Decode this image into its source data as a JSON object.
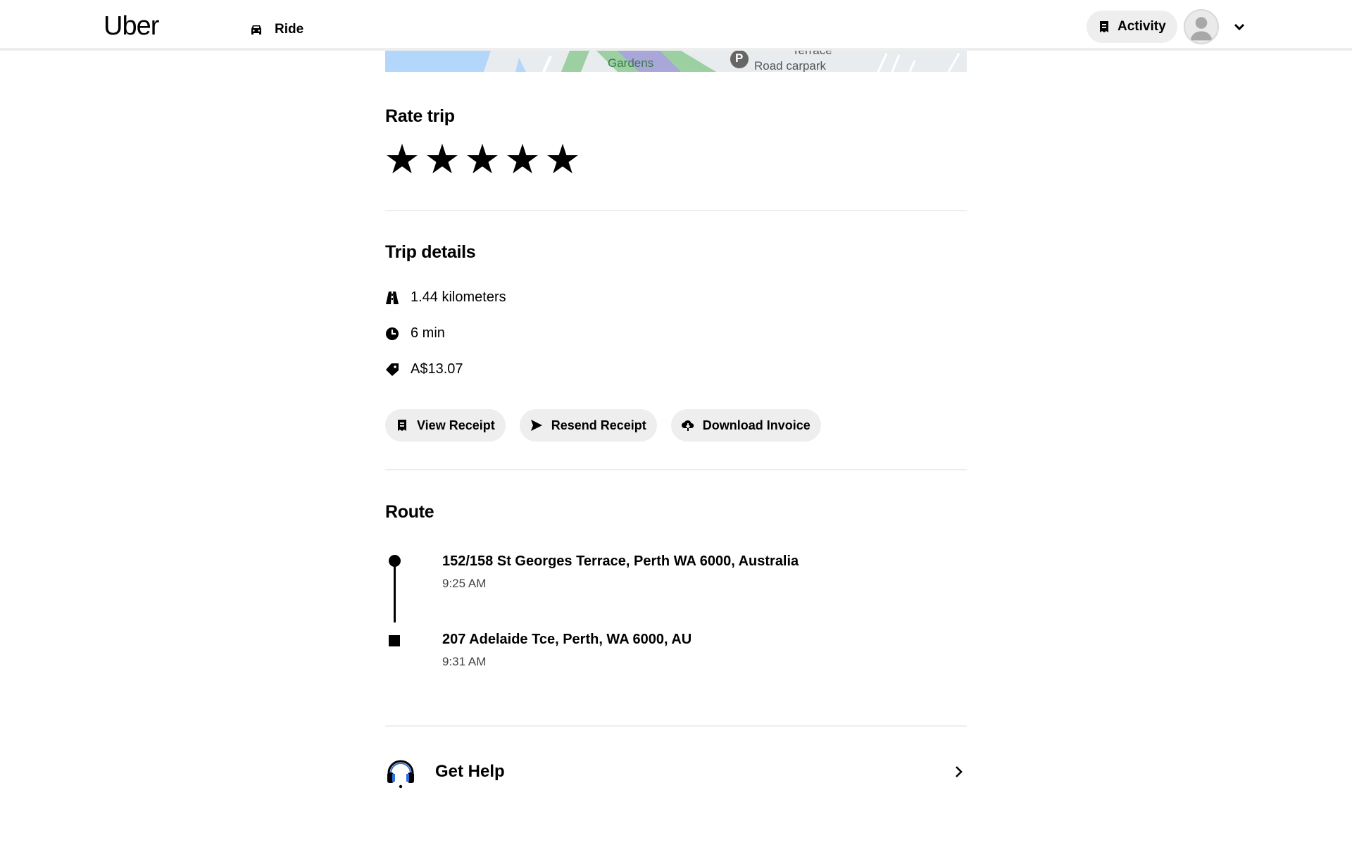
{
  "header": {
    "logo": "Uber",
    "nav_ride": "Ride",
    "activity": "Activity"
  },
  "map": {
    "labels": [
      "Gardens",
      "Terrace",
      "Road carpark"
    ],
    "parking_letter": "P"
  },
  "rating": {
    "title": "Rate trip",
    "stars": [
      "★",
      "★",
      "★",
      "★",
      "★"
    ]
  },
  "trip_details": {
    "title": "Trip details",
    "distance": "1.44 kilometers",
    "duration": "6 min",
    "fare": "A$13.07"
  },
  "actions": {
    "view_receipt": "View Receipt",
    "resend_receipt": "Resend Receipt",
    "download_invoice": "Download Invoice"
  },
  "route": {
    "title": "Route",
    "pickup_address": "152/158 St Georges Terrace, Perth WA 6000, Australia",
    "pickup_time": "9:25 AM",
    "dropoff_address": "207 Adelaide Tce, Perth, WA 6000, AU",
    "dropoff_time": "9:31 AM"
  },
  "help": {
    "label": "Get Help"
  },
  "icons": [
    "car-icon",
    "receipt-icon",
    "avatar-icon",
    "chevron-down-icon",
    "road-icon",
    "clock-icon",
    "tag-icon",
    "send-icon",
    "cloud-download-icon",
    "headset-icon",
    "chevron-right-icon"
  ],
  "colors": {
    "pill_bg": "#eeeeee",
    "divider": "#eeeeee",
    "headset_accent": "#2f6fe0"
  }
}
